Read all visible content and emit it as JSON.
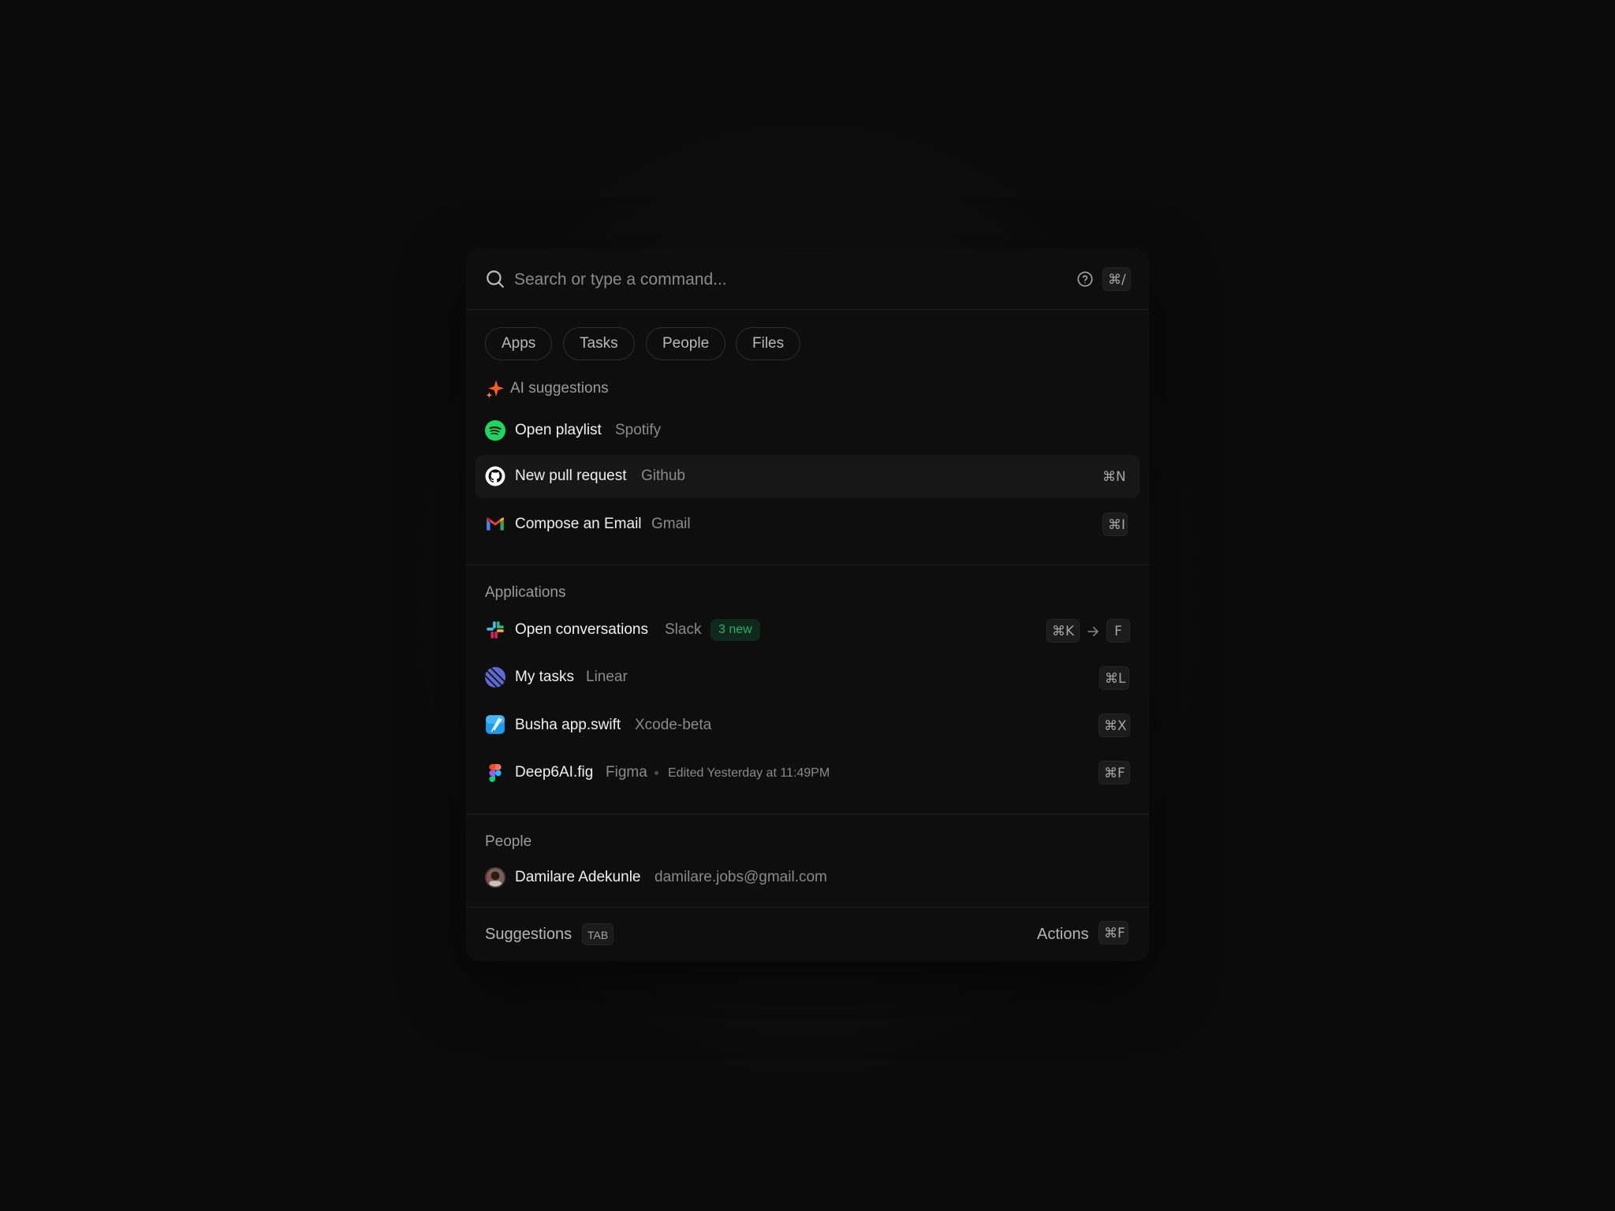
{
  "search": {
    "placeholder": "Search or type a command...",
    "help_shortcut": "⌘/"
  },
  "filters": [
    {
      "label": "Apps"
    },
    {
      "label": "Tasks"
    },
    {
      "label": "People"
    },
    {
      "label": "Files"
    }
  ],
  "ai_suggestions": {
    "heading": "AI suggestions",
    "items": [
      {
        "title": "Open playlist",
        "app": "Spotify",
        "icon": "spotify-icon",
        "shortcut": ""
      },
      {
        "title": "New pull request",
        "app": "Github",
        "icon": "github-icon",
        "shortcut": "⌘N",
        "highlighted": true
      },
      {
        "title": "Compose an Email",
        "app": "Gmail",
        "icon": "gmail-icon",
        "shortcut": "⌘I"
      }
    ]
  },
  "applications": {
    "heading": "Applications",
    "items": [
      {
        "title": "Open conversations",
        "app": "Slack",
        "icon": "slack-icon",
        "badge": "3 new",
        "shortcut": "⌘K",
        "shortcut_then": "F"
      },
      {
        "title": "My tasks",
        "app": "Linear",
        "icon": "linear-icon",
        "shortcut": "⌘L"
      },
      {
        "title": "Busha app.swift",
        "app": "Xcode-beta",
        "icon": "xcode-icon",
        "shortcut": "⌘X"
      },
      {
        "title": "Deep6AI.fig",
        "app": "Figma",
        "icon": "figma-icon",
        "meta": "Edited Yesterday at 11:49PM",
        "shortcut": "⌘F"
      }
    ]
  },
  "people": {
    "heading": "People",
    "items": [
      {
        "name": "Damilare Adekunle",
        "email": "damilare.jobs@gmail.com"
      }
    ]
  },
  "footer": {
    "suggestions_label": "Suggestions",
    "suggestions_key": "TAB",
    "actions_label": "Actions",
    "actions_key": "⌘F"
  },
  "colors": {
    "accent_sparkle": "#ff5a1f",
    "badge_green": "#27b066",
    "spotify": "#1ed760",
    "linear": "#5e6ad2",
    "xcode": "#1c9bf0"
  }
}
